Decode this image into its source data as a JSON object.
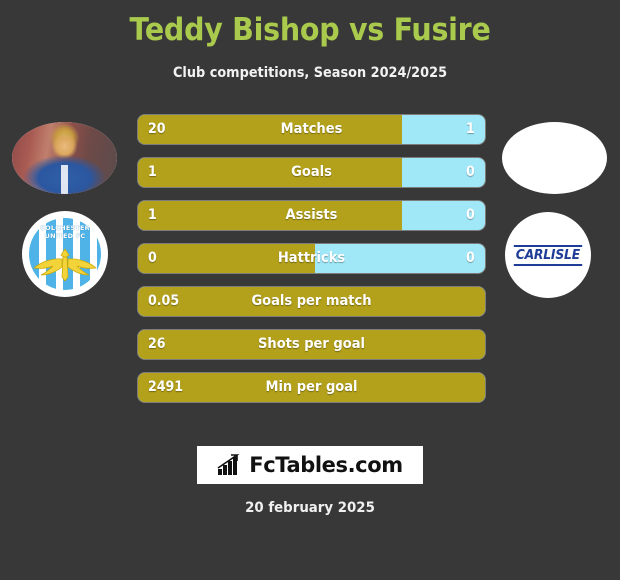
{
  "header": {
    "title": "Teddy Bishop vs Fusire",
    "subtitle": "Club competitions, Season 2024/2025",
    "title_color": "#a9ca4c"
  },
  "colors": {
    "background": "#383838",
    "left_bar": "#b3a01b",
    "right_bar": "#a0e8f8",
    "text": "#ffffff"
  },
  "left_player": {
    "photo_alt": "player-photo",
    "club_name_line1": "COLCHESTER",
    "club_name_line2": "UNITED FC"
  },
  "right_player": {
    "photo_alt": "player-photo-placeholder",
    "club_name": "CARLISLE"
  },
  "chart_data": {
    "type": "bar",
    "title": "Teddy Bishop vs Fusire",
    "subtitle": "Club competitions, Season 2024/2025",
    "orientation": "horizontal-diverging",
    "series": [
      {
        "name": "Teddy Bishop",
        "color": "#b3a01b",
        "side": "left"
      },
      {
        "name": "Fusire",
        "color": "#a0e8f8",
        "side": "right"
      }
    ],
    "categories": [
      "Matches",
      "Goals",
      "Assists",
      "Hattricks",
      "Goals per match",
      "Shots per goal",
      "Min per goal"
    ],
    "rows": [
      {
        "label": "Matches",
        "left_value": "20",
        "right_value": "1",
        "left_pct": 76,
        "has_right": true
      },
      {
        "label": "Goals",
        "left_value": "1",
        "right_value": "0",
        "left_pct": 76,
        "has_right": true
      },
      {
        "label": "Assists",
        "left_value": "1",
        "right_value": "0",
        "left_pct": 76,
        "has_right": true
      },
      {
        "label": "Hattricks",
        "left_value": "0",
        "right_value": "0",
        "left_pct": 51,
        "has_right": true
      },
      {
        "label": "Goals per match",
        "left_value": "0.05",
        "right_value": "",
        "left_pct": 100,
        "has_right": false
      },
      {
        "label": "Shots per goal",
        "left_value": "26",
        "right_value": "",
        "left_pct": 100,
        "has_right": false
      },
      {
        "label": "Min per goal",
        "left_value": "2491",
        "right_value": "",
        "left_pct": 100,
        "has_right": false
      }
    ]
  },
  "footer": {
    "logo_text": "FcTables.com",
    "logo_icon": "bar-chart-icon",
    "date": "20 february 2025"
  }
}
